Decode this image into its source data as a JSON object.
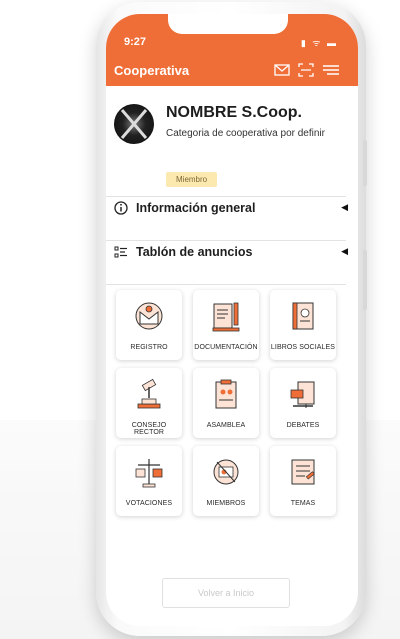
{
  "status": {
    "time": "9:27",
    "icons": "▮ ᯤ ▬"
  },
  "appbar": {
    "title": "Cooperativa",
    "icons": [
      "mail-icon",
      "scan-icon",
      "menu-icon"
    ]
  },
  "profile": {
    "name": "NOMBRE S.Coop.",
    "category": "Categoria de cooperativa por definir",
    "role_badge": "Miembro"
  },
  "sections": [
    {
      "label": "Información general",
      "icon": "info-icon"
    },
    {
      "label": "Tablón de anuncios",
      "icon": "list-icon"
    }
  ],
  "tiles": [
    {
      "label": "REGISTRO",
      "icon": "envelope-person-icon"
    },
    {
      "label": "DOCUMENTACIÓN",
      "icon": "document-pen-icon"
    },
    {
      "label": "LIBROS SOCIALES",
      "icon": "book-icon"
    },
    {
      "label": "CONSEJO RECTOR",
      "icon": "gavel-icon"
    },
    {
      "label": "ASAMBLEA",
      "icon": "clipboard-people-icon"
    },
    {
      "label": "DEBATES",
      "icon": "debate-board-icon"
    },
    {
      "label": "VOTACIONES",
      "icon": "ballot-scale-icon"
    },
    {
      "label": "MIEMBROS",
      "icon": "member-badge-icon"
    },
    {
      "label": "TEMAS",
      "icon": "notes-icon"
    }
  ],
  "footer": {
    "back_label": "Volver a Inicio"
  },
  "colors": {
    "accent": "#ef6e37",
    "badge_bg": "#fce9b0"
  }
}
